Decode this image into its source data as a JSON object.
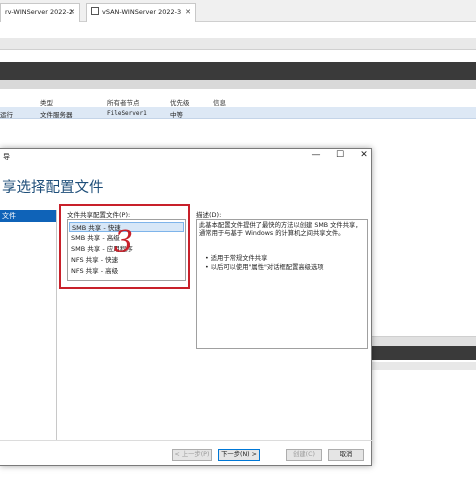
{
  "browser_tabs": [
    {
      "label": "rv-WINServer 2022-2"
    },
    {
      "label": "vSAN-WINServer 2022-3"
    }
  ],
  "server_table": {
    "columns": [
      "类型",
      "所有者节点",
      "优先级",
      "信息"
    ],
    "row": {
      "status": "运行",
      "type": "文件服务器",
      "owner": "FileServer1",
      "priority": "中等"
    }
  },
  "dialog": {
    "title_fragment": "导",
    "window_buttons": {
      "minimize": "—",
      "maximize": "☐",
      "close": "✕"
    },
    "heading": "享选择配置文件",
    "nav": {
      "selected": "文件"
    },
    "profile_list": {
      "label": "文件共享配置文件(P):",
      "items": [
        "SMB 共享 - 快速",
        "SMB 共享 - 高级",
        "SMB 共享 - 应用程序",
        "NFS 共享 - 快速",
        "NFS 共享 - 高级"
      ],
      "selected_index": 0
    },
    "annotation_mark": "3",
    "description": {
      "label": "描述(D):",
      "text": "此基本配置文件提供了最快的方法以创建 SMB 文件共享，通常用于与基于 Windows 的计算机之间共享文件。",
      "bullets": [
        "适用于常规文件共享",
        "以后可以使用\"属性\"对话框配置高级选项"
      ]
    },
    "footer_buttons": {
      "prev": "< 上一步(P)",
      "next": "下一步(N) >",
      "create": "创建(C)",
      "cancel": "取消"
    }
  },
  "colors": {
    "heading": "#1e4e79",
    "selection": "#0f63b8",
    "annotation_red": "#c8202a"
  }
}
